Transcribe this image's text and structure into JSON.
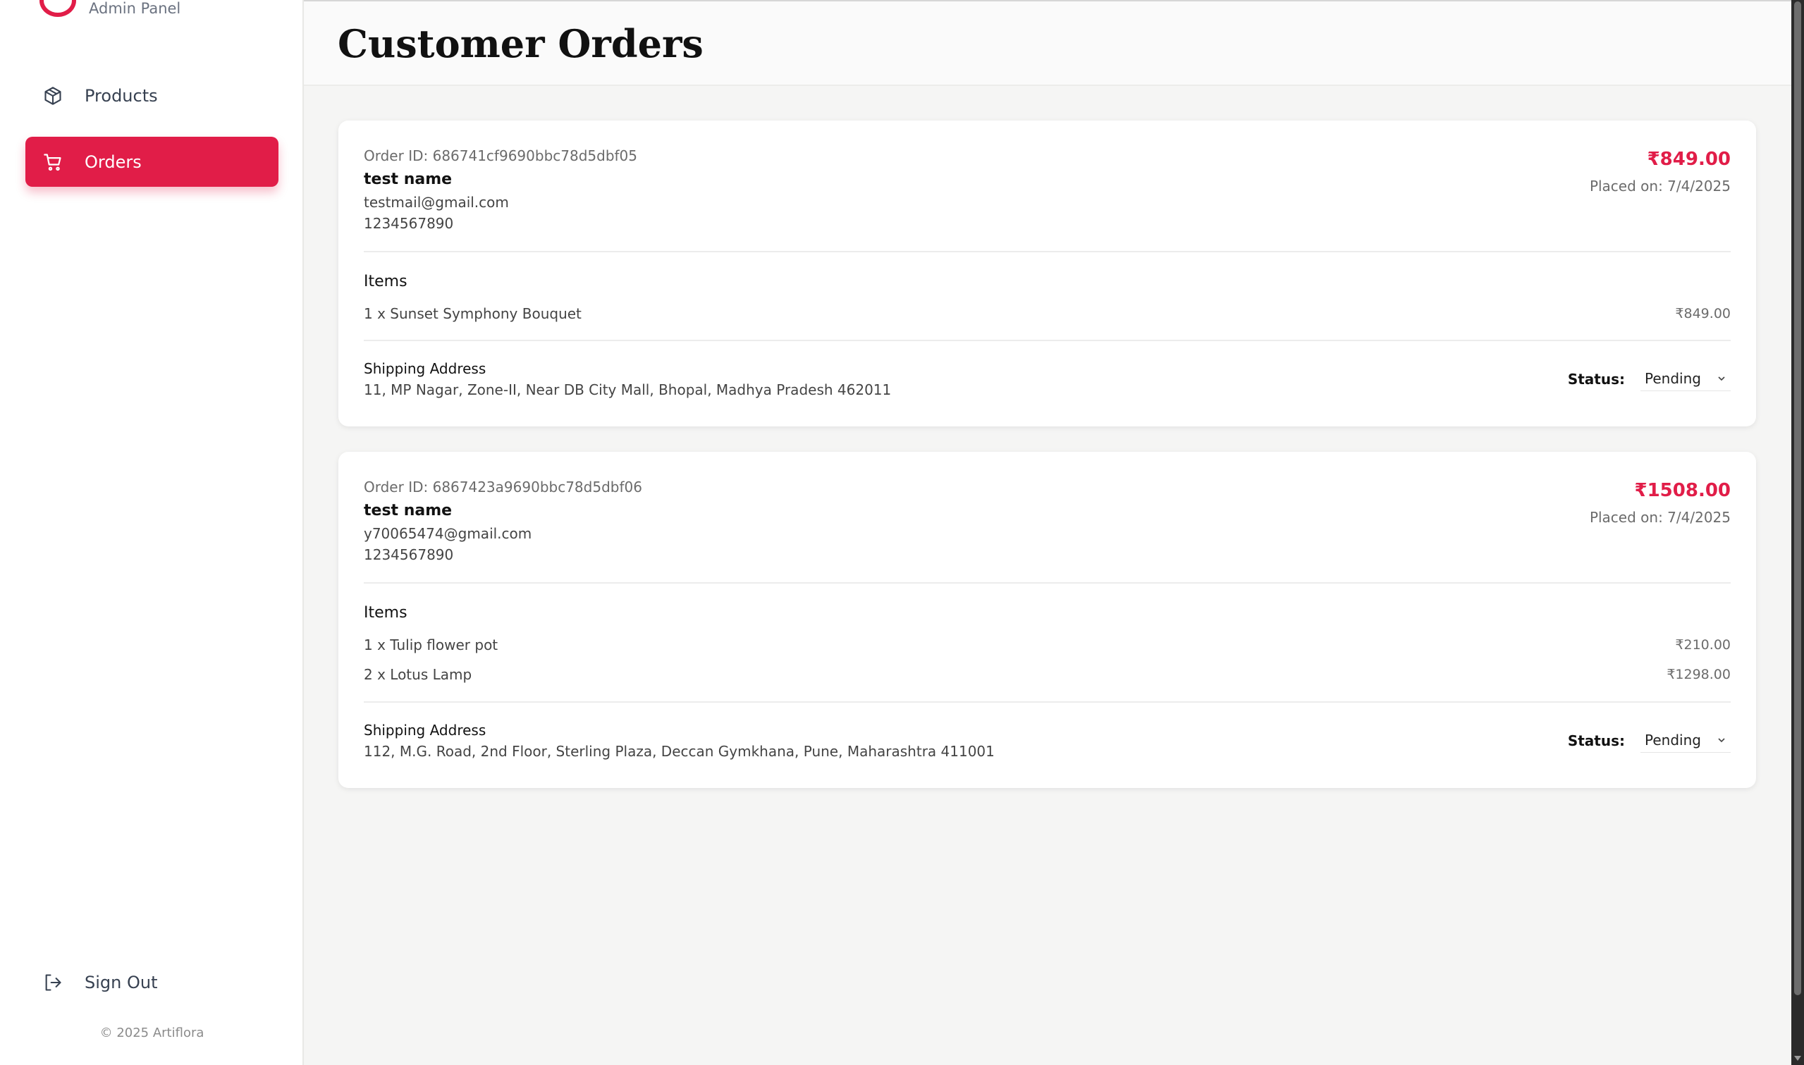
{
  "sidebar": {
    "brand_subtitle": "Admin Panel",
    "nav": [
      {
        "label": "Products",
        "icon": "package-icon",
        "active": false
      },
      {
        "label": "Orders",
        "icon": "shopping-cart-icon",
        "active": true
      }
    ],
    "sign_out_label": "Sign Out",
    "copyright": "© 2025 Artiflora"
  },
  "header": {
    "title": "Customer Orders"
  },
  "colors": {
    "accent": "#e11d48",
    "background": "#f5f5f4",
    "card": "#ffffff"
  },
  "orders": [
    {
      "order_id": "Order ID: 686741cf9690bbc78d5dbf05",
      "customer_name": "test name",
      "email": "testmail@gmail.com",
      "phone": "1234567890",
      "total": "₹849.00",
      "placed_on": "Placed on: 7/4/2025",
      "items_heading": "Items",
      "items": [
        {
          "name": "1 x Sunset Symphony Bouquet",
          "price": "₹849.00"
        }
      ],
      "shipping_heading": "Shipping Address",
      "shipping_address": "11, MP Nagar, Zone-II, Near DB City Mall, Bhopal, Madhya Pradesh 462011",
      "status_label": "Status:",
      "status_value": "Pending"
    },
    {
      "order_id": "Order ID: 6867423a9690bbc78d5dbf06",
      "customer_name": "test name",
      "email": "y70065474@gmail.com",
      "phone": "1234567890",
      "total": "₹1508.00",
      "placed_on": "Placed on: 7/4/2025",
      "items_heading": "Items",
      "items": [
        {
          "name": "1 x Tulip flower pot",
          "price": "₹210.00"
        },
        {
          "name": "2 x Lotus Lamp",
          "price": "₹1298.00"
        }
      ],
      "shipping_heading": "Shipping Address",
      "shipping_address": "112, M.G. Road, 2nd Floor, Sterling Plaza, Deccan Gymkhana, Pune, Maharashtra 411001",
      "status_label": "Status:",
      "status_value": "Pending"
    }
  ]
}
